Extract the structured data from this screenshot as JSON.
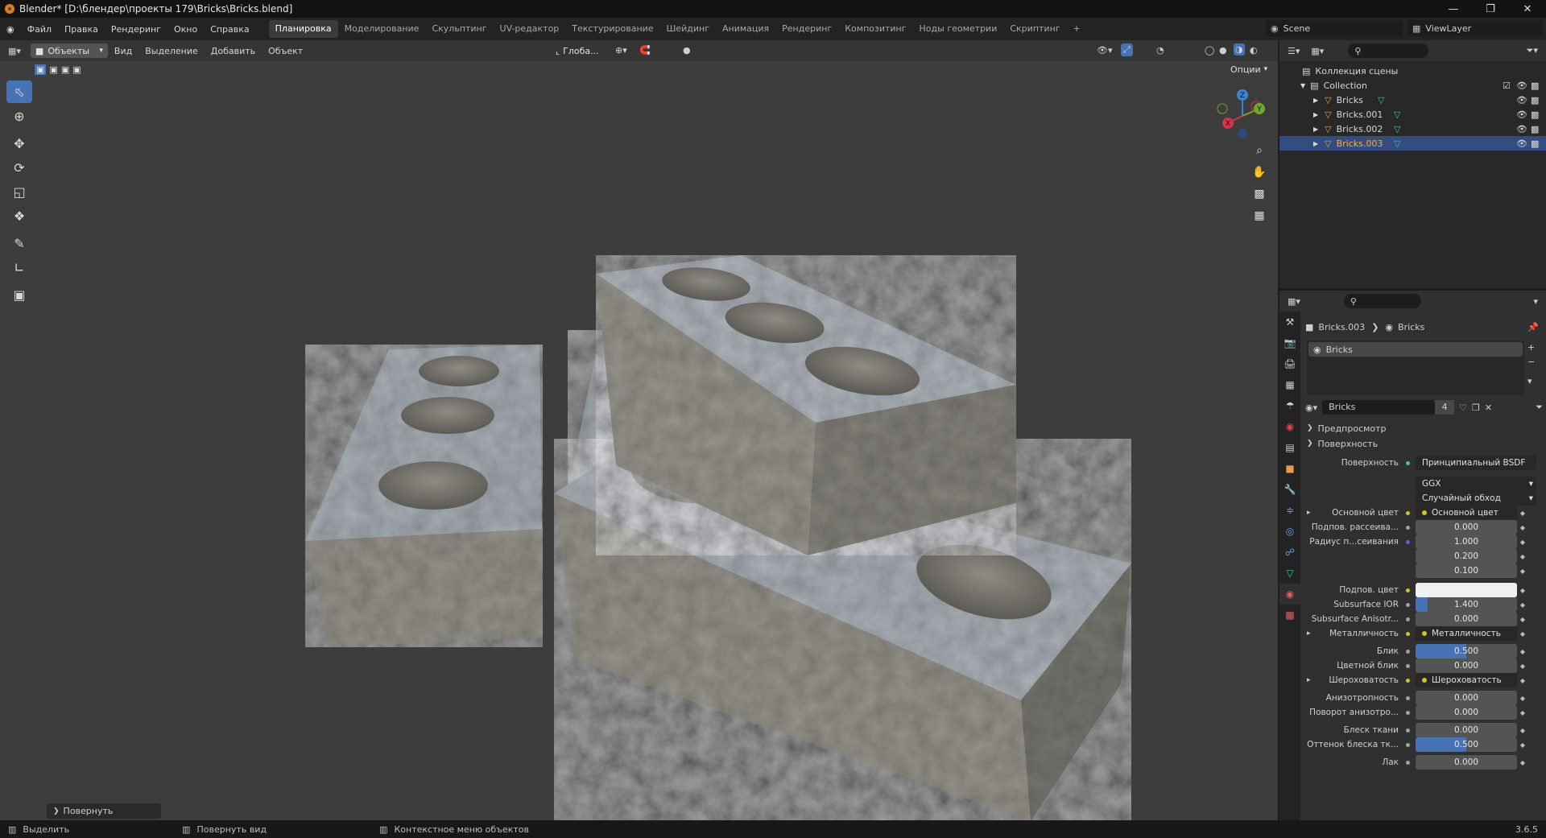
{
  "window": {
    "title": "Blender* [D:\\блендер\\проекты 179\\Bricks\\Bricks.blend]"
  },
  "menu": [
    "Файл",
    "Правка",
    "Рендеринг",
    "Окно",
    "Справка"
  ],
  "workspaces": [
    "Планировка",
    "Моделирование",
    "Скульптинг",
    "UV-редактор",
    "Текстурирование",
    "Шейдинг",
    "Анимация",
    "Рендеринг",
    "Композитинг",
    "Ноды геометрии",
    "Скриптинг"
  ],
  "workspace_add": "+",
  "scene": {
    "name": "Scene",
    "view_layer": "ViewLayer"
  },
  "viewport": {
    "mode": "Объекты",
    "menus": [
      "Вид",
      "Выделение",
      "Добавить",
      "Объект"
    ],
    "orientation": "Глоба...",
    "options": "Опции",
    "operator_panel": "Повернуть",
    "gizmo": {
      "x": "X",
      "y": "Y",
      "z": "Z"
    }
  },
  "outliner": {
    "scene_collection": "Коллекция сцены",
    "collection": "Collection",
    "objects": [
      "Bricks",
      "Bricks.001",
      "Bricks.002",
      "Bricks.003"
    ],
    "selected": "Bricks.003"
  },
  "properties": {
    "breadcrumb": [
      "Bricks.003",
      "Bricks"
    ],
    "slot": "Bricks",
    "material": "Bricks",
    "users": "4",
    "panels": {
      "preview": "Предпросмотр",
      "surface": "Поверхность"
    },
    "surface_label": "Поверхность",
    "surface_value": "Принципиальный BSDF",
    "dist": "GGX",
    "sss_method": "Случайный обход",
    "rows": [
      {
        "label": "Основной цвет",
        "value": "Основной цвет",
        "kind": "link"
      },
      {
        "label": "Подпов. рассеива...",
        "value": "0.000",
        "kind": "field",
        "fill": 0
      },
      {
        "label": "Радиус п...сеивания",
        "value": "1.000",
        "kind": "field",
        "fill": 0
      },
      {
        "label": "",
        "value": "0.200",
        "kind": "field",
        "fill": 0
      },
      {
        "label": "",
        "value": "0.100",
        "kind": "field",
        "fill": 0
      },
      {
        "label": "Подпов. цвет",
        "value": "",
        "kind": "color"
      },
      {
        "label": "Subsurface IOR",
        "value": "1.400",
        "kind": "field",
        "fill": 0.12
      },
      {
        "label": "Subsurface Anisotr...",
        "value": "0.000",
        "kind": "field",
        "fill": 0
      },
      {
        "label": "Металличность",
        "value": "Металличность",
        "kind": "link"
      },
      {
        "label": "Блик",
        "value": "0.500",
        "kind": "field",
        "fill": 0.5
      },
      {
        "label": "Цветной блик",
        "value": "0.000",
        "kind": "field",
        "fill": 0
      },
      {
        "label": "Шероховатость",
        "value": "Шероховатость",
        "kind": "link"
      },
      {
        "label": "Анизотропность",
        "value": "0.000",
        "kind": "field",
        "fill": 0
      },
      {
        "label": "Поворот анизотро...",
        "value": "0.000",
        "kind": "field",
        "fill": 0
      },
      {
        "label": "Блеск ткани",
        "value": "0.000",
        "kind": "field",
        "fill": 0
      },
      {
        "label": "Оттенок блеска тк...",
        "value": "0.500",
        "kind": "field",
        "fill": 0.5
      },
      {
        "label": "Лак",
        "value": "0.000",
        "kind": "field",
        "fill": 0
      }
    ]
  },
  "status": {
    "select": "Выделить",
    "rotate_view": "Повернуть вид",
    "context_menu": "Контекстное меню объектов",
    "version": "3.6.5"
  },
  "colors": {
    "accent": "#4772b3",
    "selected_row": "#334d80",
    "bg": "#3d3d3d"
  }
}
